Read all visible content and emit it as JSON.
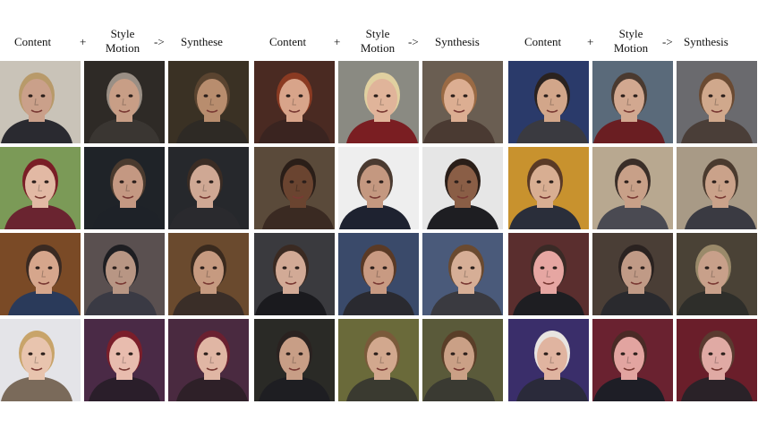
{
  "header": {
    "content_label": "Content",
    "plus_sign": "+",
    "style_label_line1": "Style",
    "style_label_line2": "Motion",
    "arrow_sign": "->",
    "synthesis_label_a": "Synthese",
    "synthesis_label_b": "Synthesis"
  },
  "groups": [
    {
      "rows": [
        {
          "content": {
            "bg": "#c9c3b8",
            "skin": "#caa08a",
            "hair": "#b89a6a",
            "shirt": "#2a2a30"
          },
          "style": {
            "bg": "#2e2a26",
            "skin": "#c89e86",
            "hair": "#9a8f85",
            "shirt": "#3a3632"
          },
          "synth": {
            "bg": "#3a3124",
            "skin": "#b88d6e",
            "hair": "#5a4430",
            "shirt": "#2e2a25"
          }
        },
        {
          "content": {
            "bg": "#7b9a57",
            "skin": "#e2b9a4",
            "hair": "#7a1e26",
            "shirt": "#6a2430"
          },
          "style": {
            "bg": "#1f2328",
            "skin": "#c49882",
            "hair": "#4a3a2e",
            "shirt": "#1e2228"
          },
          "synth": {
            "bg": "#26282c",
            "skin": "#cfa894",
            "hair": "#3a2c24",
            "shirt": "#2a2a2e"
          }
        },
        {
          "content": {
            "bg": "#7a4a26",
            "skin": "#d6a68c",
            "hair": "#3a2a22",
            "shirt": "#2a3a5a"
          },
          "style": {
            "bg": "#5a5050",
            "skin": "#b89684",
            "hair": "#1e1e22",
            "shirt": "#3a3a44"
          },
          "synth": {
            "bg": "#6a4a2e",
            "skin": "#c69a80",
            "hair": "#3a2a1e",
            "shirt": "#3a2e28"
          }
        },
        {
          "content": {
            "bg": "#e4e4e8",
            "skin": "#e8c4ae",
            "hair": "#c8a46a",
            "shirt": "#7a6a5a"
          },
          "style": {
            "bg": "#4a2a46",
            "skin": "#e8bcae",
            "hair": "#7a1e2a",
            "shirt": "#2a1e2a"
          },
          "synth": {
            "bg": "#4a2a40",
            "skin": "#e0b6a4",
            "hair": "#6a2030",
            "shirt": "#2e2028"
          }
        }
      ]
    },
    {
      "rows": [
        {
          "content": {
            "bg": "#4a2a22",
            "skin": "#d8a48a",
            "hair": "#8a3a22",
            "shirt": "#3a2420"
          },
          "style": {
            "bg": "#8a8a82",
            "skin": "#e0b49a",
            "hair": "#e0d0a0",
            "shirt": "#7a1e22"
          },
          "synth": {
            "bg": "#6a5e52",
            "skin": "#dcae92",
            "hair": "#9a6a44",
            "shirt": "#4a3a32"
          }
        },
        {
          "content": {
            "bg": "#5a4a3a",
            "skin": "#6a4430",
            "hair": "#2a1e18",
            "shirt": "#3a2a22"
          },
          "style": {
            "bg": "#eeeeee",
            "skin": "#c49880",
            "hair": "#4a3a30",
            "shirt": "#1e2230"
          },
          "synth": {
            "bg": "#e6e6e6",
            "skin": "#8a5e46",
            "hair": "#2a1e18",
            "shirt": "#1e1e22"
          }
        },
        {
          "content": {
            "bg": "#3a3a3e",
            "skin": "#d2aa96",
            "hair": "#3a2a22",
            "shirt": "#1a1a1e"
          },
          "style": {
            "bg": "#3a4a6a",
            "skin": "#c89a82",
            "hair": "#5a3a26",
            "shirt": "#2a2a30"
          },
          "synth": {
            "bg": "#4a5a7a",
            "skin": "#d6ae96",
            "hair": "#6a4a30",
            "shirt": "#3a3a40"
          }
        },
        {
          "content": {
            "bg": "#2a2a26",
            "skin": "#c89e86",
            "hair": "#2a2220",
            "shirt": "#1e1e22"
          },
          "style": {
            "bg": "#6a6a3a",
            "skin": "#d2a88e",
            "hair": "#7a5a3a",
            "shirt": "#3a3a30"
          },
          "synth": {
            "bg": "#5a5a3a",
            "skin": "#caa086",
            "hair": "#5a3e28",
            "shirt": "#3a3a32"
          }
        }
      ]
    },
    {
      "rows": [
        {
          "content": {
            "bg": "#2a3a6a",
            "skin": "#d2a68a",
            "hair": "#2a2220",
            "shirt": "#3a3a40"
          },
          "style": {
            "bg": "#5a6a7a",
            "skin": "#d2a890",
            "hair": "#4a3a30",
            "shirt": "#6a1e22"
          },
          "synth": {
            "bg": "#6a6a6e",
            "skin": "#d0a88c",
            "hair": "#6a4a32",
            "shirt": "#4a3e38"
          }
        },
        {
          "content": {
            "bg": "#c8922e",
            "skin": "#d8ae92",
            "hair": "#5a3a26",
            "shirt": "#2a2e3a"
          },
          "style": {
            "bg": "#b8a890",
            "skin": "#c8a088",
            "hair": "#3a2e28",
            "shirt": "#4a4a52"
          },
          "synth": {
            "bg": "#a89a86",
            "skin": "#caa28a",
            "hair": "#4a3a2e",
            "shirt": "#3a3a42"
          }
        },
        {
          "content": {
            "bg": "#5a2e2e",
            "skin": "#e6a6a2",
            "hair": "#3a2a26",
            "shirt": "#1e1e22"
          },
          "style": {
            "bg": "#4a3e36",
            "skin": "#c09a86",
            "hair": "#2a2220",
            "shirt": "#2a2a2e"
          },
          "synth": {
            "bg": "#4a4236",
            "skin": "#c8a08a",
            "hair": "#9a8a6a",
            "shirt": "#2e2e2a"
          }
        },
        {
          "content": {
            "bg": "#3a2e6a",
            "skin": "#e0b4a0",
            "hair": "#e8e4e0",
            "shirt": "#2a2a3a"
          },
          "style": {
            "bg": "#6a2230",
            "skin": "#e2a4a0",
            "hair": "#4a2a26",
            "shirt": "#1e1e26"
          },
          "synth": {
            "bg": "#6a1e2a",
            "skin": "#e0aaa4",
            "hair": "#5a3a30",
            "shirt": "#2a2228"
          }
        }
      ]
    }
  ]
}
